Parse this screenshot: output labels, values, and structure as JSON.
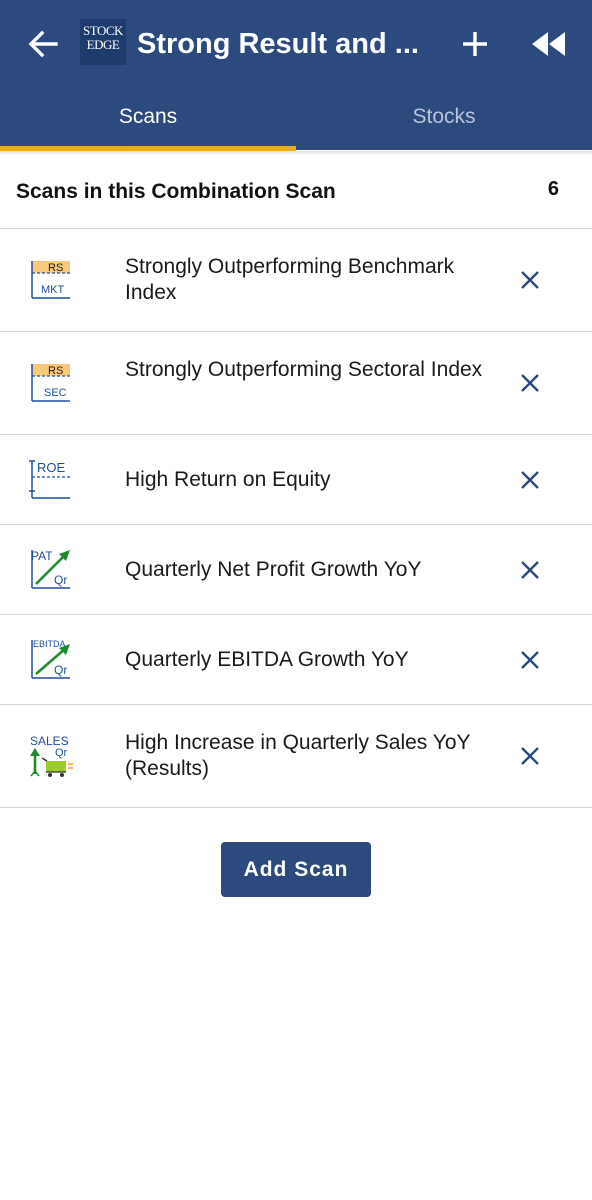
{
  "appbar": {
    "title": "Strong Result and ...",
    "logo_lines": [
      "STOCK",
      "EDGE"
    ],
    "back_icon": "arrow-left-icon",
    "add_icon": "plus-icon",
    "rewind_icon": "rewind-icon"
  },
  "tabs": [
    {
      "label": "Scans",
      "active": true
    },
    {
      "label": "Stocks",
      "active": false
    }
  ],
  "section": {
    "title": "Scans in this Combination Scan",
    "count": "6"
  },
  "scans": [
    {
      "label": "Strongly Outperforming Benchmark Index",
      "icon": "rs-mkt-icon",
      "icon_text": [
        "RS",
        "MKT"
      ]
    },
    {
      "label": "Strongly Outperforming Sectoral Index",
      "icon": "rs-sec-icon",
      "icon_text": [
        "RS",
        "SEC"
      ]
    },
    {
      "label": "High Return on Equity",
      "icon": "roe-icon",
      "icon_text": [
        "ROE"
      ]
    },
    {
      "label": "Quarterly Net Profit Growth YoY",
      "icon": "pat-growth-icon",
      "icon_text": [
        "PAT",
        "Qr"
      ]
    },
    {
      "label": "Quarterly EBITDA Growth YoY",
      "icon": "ebitda-growth-icon",
      "icon_text": [
        "EBITDA",
        "Qr"
      ]
    },
    {
      "label": "High Increase in Quarterly Sales YoY (Results)",
      "icon": "sales-growth-icon",
      "icon_text": [
        "SALES",
        "Qr"
      ]
    }
  ],
  "add_scan_label": "Add Scan",
  "colors": {
    "primary": "#2c4a7e",
    "tab_indicator": "#f0a824",
    "icon_blue": "#1f4f9c",
    "icon_green": "#1e8a2e",
    "icon_highlight": "#f9c97a"
  }
}
